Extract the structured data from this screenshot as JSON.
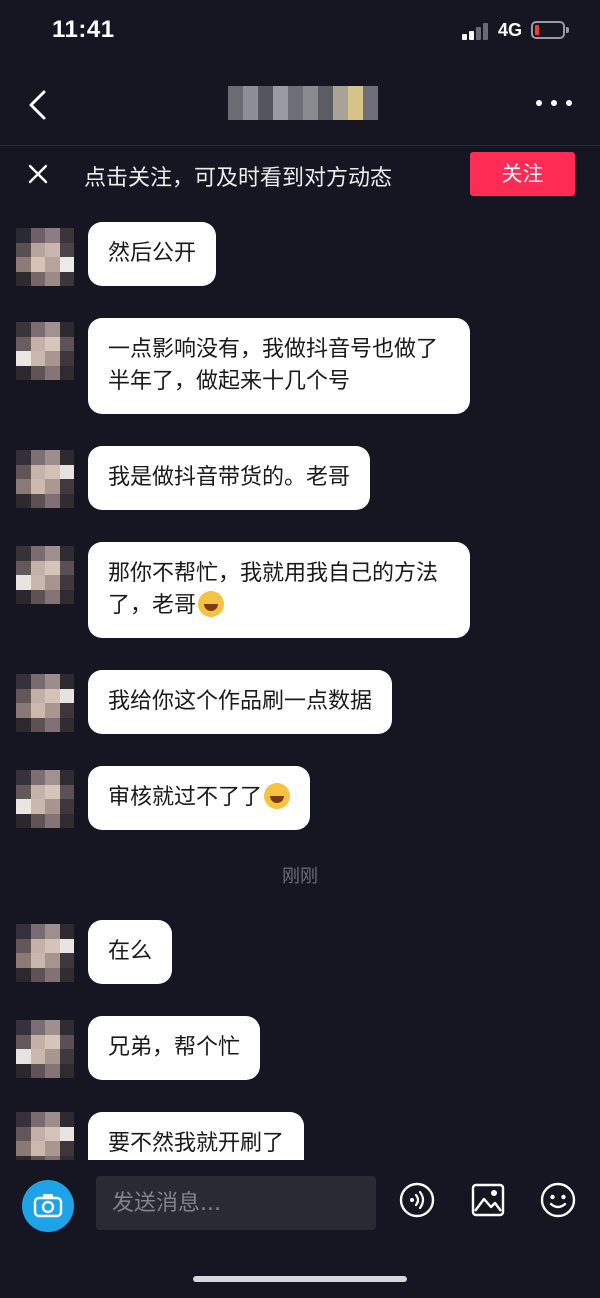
{
  "status_bar": {
    "time": "11:41",
    "network": "4G",
    "battery_color": "#ff3b30"
  },
  "header": {
    "back_icon": "chevron-left-icon",
    "more_icon": "more-horizontal-icon"
  },
  "follow_banner": {
    "close_icon": "close-icon",
    "text": "点击关注，可及时看到对方动态",
    "button_label": "关注",
    "button_color": "#fe2c55"
  },
  "messages": [
    {
      "text": "然后公开"
    },
    {
      "text": "一点影响没有，我做抖音号也做了半年了，做起来十几个号"
    },
    {
      "text": "我是做抖音带货的。老哥"
    },
    {
      "text": "那你不帮忙，我就用我自己的方法了，老哥",
      "emoji": "rolling-laughing-emoji"
    },
    {
      "text": "我给你这个作品刷一点数据"
    },
    {
      "text": "审核就过不了了",
      "emoji": "rolling-laughing-emoji"
    },
    {
      "text": "在么"
    },
    {
      "text": "兄弟，帮个忙"
    },
    {
      "text": "要不然我就开刷了"
    }
  ],
  "timestamp": "刚刚",
  "input_bar": {
    "placeholder": "发送消息...",
    "camera_icon": "camera-icon",
    "voice_icon": "voice-icon",
    "image_icon": "image-icon",
    "emoji_icon": "smiley-icon"
  }
}
